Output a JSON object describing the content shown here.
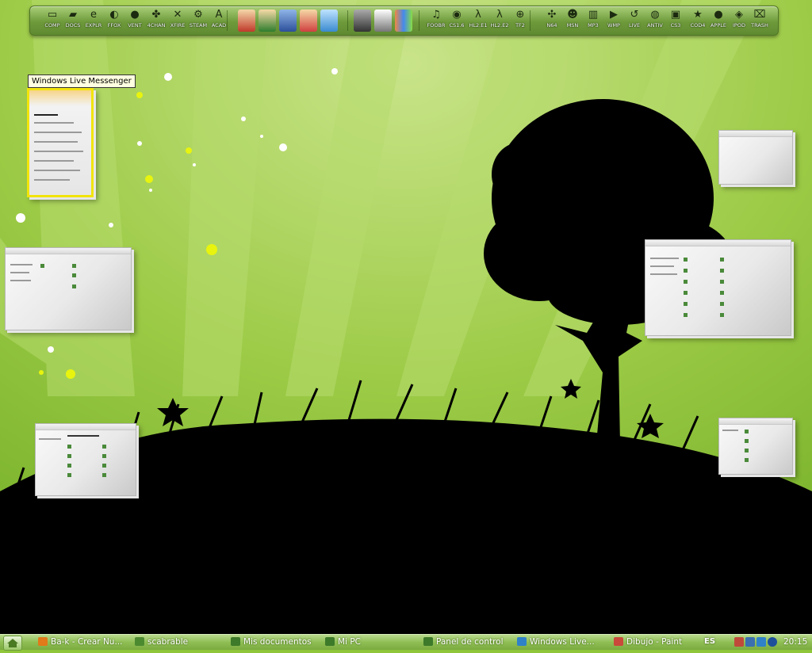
{
  "dock": {
    "items": [
      {
        "label": "COMP",
        "icon": "monitor-icon",
        "glyph": "▭"
      },
      {
        "label": "DOCS",
        "icon": "folder-icon",
        "glyph": "▰"
      },
      {
        "label": "EXPLR",
        "icon": "ie-icon",
        "glyph": "e"
      },
      {
        "label": "FFOX",
        "icon": "firefox-icon",
        "glyph": "◐"
      },
      {
        "label": "VENT",
        "icon": "ventrilo-icon",
        "glyph": "●"
      },
      {
        "label": "4CHAN",
        "icon": "clover-icon",
        "glyph": "✤"
      },
      {
        "label": "XFIRE",
        "icon": "xfire-icon",
        "glyph": "✕"
      },
      {
        "label": "STEAM",
        "icon": "steam-icon",
        "glyph": "⚙"
      },
      {
        "label": "ACAD",
        "icon": "autocad-icon",
        "glyph": "A"
      },
      {
        "label": "FOOBR",
        "icon": "foobar-icon",
        "glyph": "♫"
      },
      {
        "label": "CS1.6",
        "icon": "counter-strike-icon",
        "glyph": "◉"
      },
      {
        "label": "HL2.E1",
        "icon": "half-life-icon",
        "glyph": "λ"
      },
      {
        "label": "HL2.E2",
        "icon": "half-life-icon",
        "glyph": "λ"
      },
      {
        "label": "TF2",
        "icon": "team-fortress-icon",
        "glyph": "⊕"
      },
      {
        "label": "N64",
        "icon": "nintendo64-icon",
        "glyph": "✣"
      },
      {
        "label": "MSN",
        "icon": "messenger-icon",
        "glyph": "☻"
      },
      {
        "label": "MP3",
        "icon": "equalizer-icon",
        "glyph": "▥"
      },
      {
        "label": "WMP",
        "icon": "media-player-icon",
        "glyph": "▶"
      },
      {
        "label": "LIVE",
        "icon": "live-icon",
        "glyph": "↺"
      },
      {
        "label": "ANTIV",
        "icon": "antivirus-icon",
        "glyph": "◍"
      },
      {
        "label": "CS3",
        "icon": "photoshop-icon",
        "glyph": "▣"
      },
      {
        "label": "COD4",
        "icon": "call-of-duty-icon",
        "glyph": "★"
      },
      {
        "label": "APPLE",
        "icon": "apple-icon",
        "glyph": "●"
      },
      {
        "label": "IPOD",
        "icon": "ipod-icon",
        "glyph": "◈"
      },
      {
        "label": "TRASH",
        "icon": "trash-icon",
        "glyph": "⌧"
      }
    ]
  },
  "tooltip": {
    "text": "Windows Live Messenger"
  },
  "taskbar": {
    "tasks": [
      {
        "label": "Ba-k - Crear Nu...",
        "icon": "firefox-icon",
        "color": "#e07a1a"
      },
      {
        "label": "scabrable",
        "icon": "chat-window-icon",
        "color": "#4c8a30"
      },
      {
        "label": "Mis documentos",
        "icon": "folder-icon",
        "color": "#3d7a2a"
      },
      {
        "label": "Mi PC",
        "icon": "computer-icon",
        "color": "#3d7a2a"
      },
      {
        "label": "Panel de control",
        "icon": "control-panel-icon",
        "color": "#3d7a2a"
      },
      {
        "label": "Windows Live...",
        "icon": "messenger-icon",
        "color": "#2f82c8"
      },
      {
        "label": "Dibujo - Paint",
        "icon": "paint-icon",
        "color": "#c94a3a"
      }
    ],
    "language": "ES",
    "clock": "20:15"
  },
  "colors": {
    "wallpaper": "#8fc63a",
    "dock": "#6e9a3b",
    "highlight": "#f2e40a"
  }
}
